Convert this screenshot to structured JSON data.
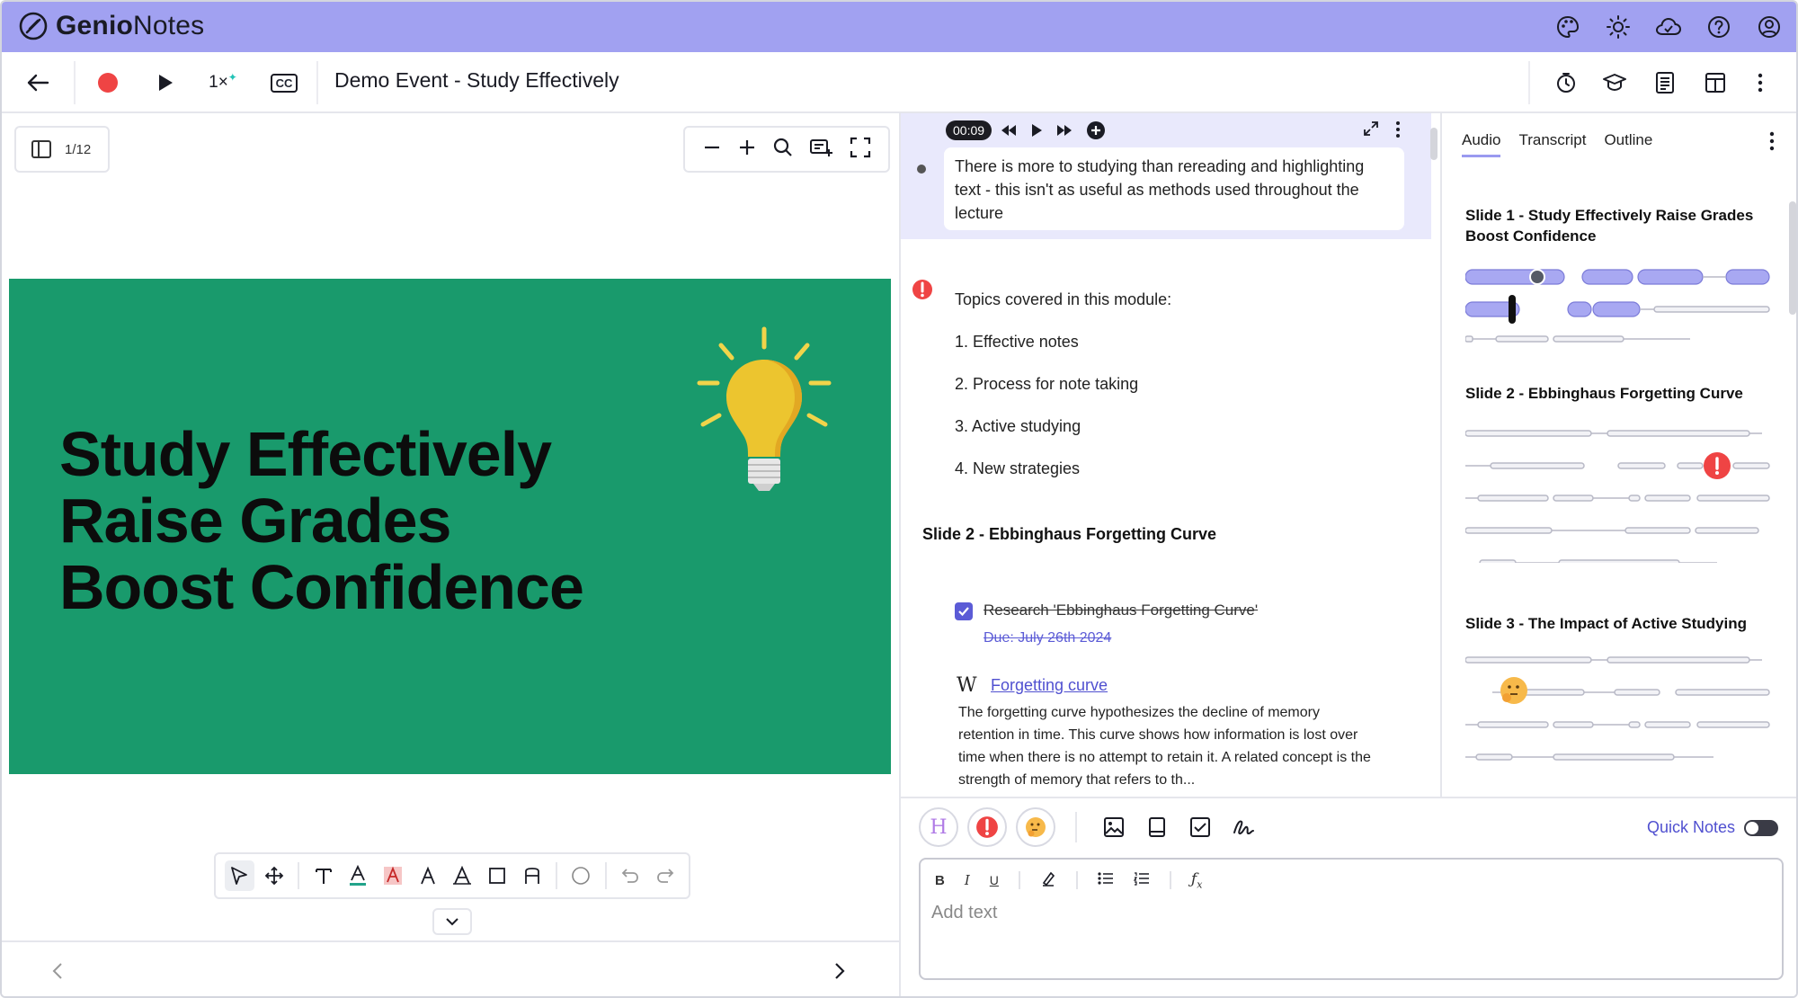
{
  "app": {
    "logo_brand": "Genio",
    "logo_suffix": "Notes"
  },
  "topbar": {
    "icons": [
      "palette-icon",
      "sun-icon",
      "cloud-icon",
      "help-icon",
      "account-icon"
    ]
  },
  "toolbar": {
    "speed": "1×",
    "cc": "CC",
    "title": "Demo Event - Study Effectively"
  },
  "viewer": {
    "page_indicator": "1/12",
    "slide_title_lines": [
      "Study Effectively",
      "Raise Grades",
      "Boost Confidence"
    ]
  },
  "player": {
    "time": "00:09"
  },
  "transcript_bubble": "There is more to studying than rereading and highlighting text - this isn't as useful as methods used throughout the lecture",
  "notes": {
    "topics_header": "Topics covered in this module:",
    "topics": [
      "1. Effective notes",
      "2. Process for note taking",
      "3. Active studying",
      "4. New strategies"
    ],
    "slide2_heading": "Slide 2 - Ebbinghaus Forgetting Curve",
    "task": {
      "text": "Research 'Ebbinghaus Forgetting Curve'",
      "due": "Due: July 26th 2024",
      "done": true
    },
    "wiki": {
      "icon": "W",
      "link": "Forgetting curve",
      "text": "The forgetting curve hypothesizes the decline of memory retention in time. This curve shows how information is lost over time when there is no attempt to retain it. A related concept is the strength of memory that refers to th..."
    }
  },
  "editor": {
    "quick_notes_label": "Quick Notes",
    "quick_notes_on": false,
    "placeholder": "Add text",
    "format_buttons": [
      "B",
      "I",
      "U"
    ]
  },
  "outline": {
    "tabs": [
      "Audio",
      "Transcript",
      "Outline"
    ],
    "active_tab": "Audio",
    "sections": [
      "Slide 1 - Study Effectively Raise Grades Boost Confidence",
      "Slide 2 - Ebbinghaus Forgetting Curve",
      "Slide 3 - The Impact of Active Studying"
    ]
  },
  "colors": {
    "topbar": "#a1a1f1",
    "slide_bg": "#199a6c",
    "accent": "#5b5bd6",
    "alert": "#ef4444"
  }
}
